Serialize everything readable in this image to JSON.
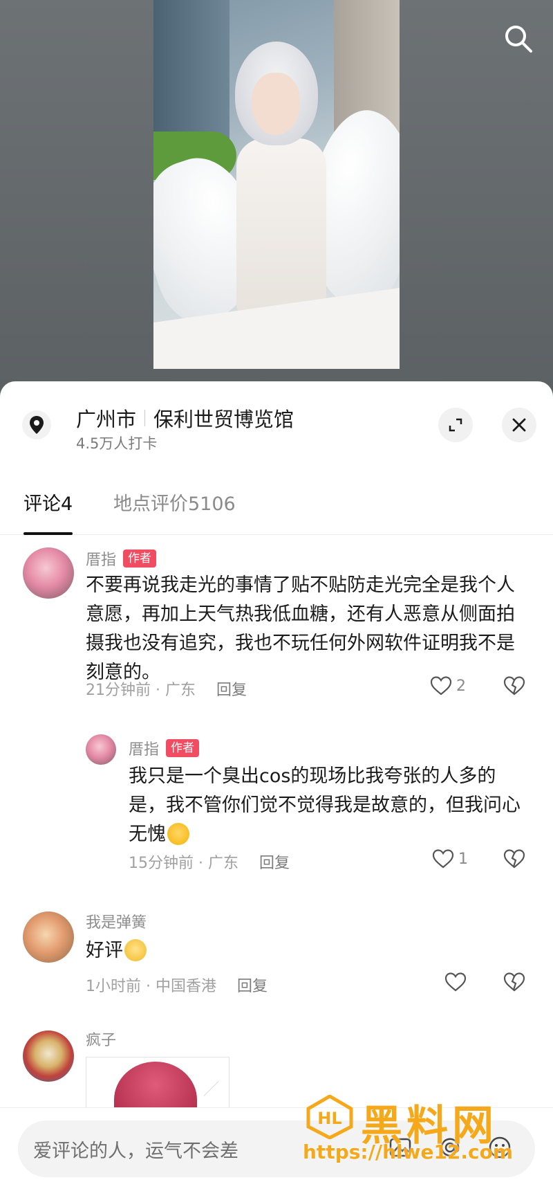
{
  "location": {
    "city": "广州市",
    "venue": "保利世贸博览馆",
    "checkins": "4.5万人打卡"
  },
  "tabs": [
    {
      "label": "评论",
      "count": "4"
    },
    {
      "label": "地点评价",
      "count": "5106"
    }
  ],
  "comments": [
    {
      "user": "厝指",
      "badge": "作者",
      "text": "不要再说我走光的事情了贴不贴防走光完全是我个人意愿，再加上天气热我低血糖，还有人恶意从侧面拍摄我也没有追究，我也不玩任何外网软件证明我不是刻意的。",
      "time": "21分钟前 · 广东",
      "reply": "回复",
      "likes": "2"
    },
    {
      "user": "厝指",
      "badge": "作者",
      "text": "我只是一个臭出cos的现场比我夸张的人多的是，我不管你们觉不觉得我是故意的，但我问心无愧",
      "emoji": "laugh-cry-emoji",
      "time": "15分钟前 · 广东",
      "reply": "回复",
      "likes": "1"
    },
    {
      "user": "我是弹簧",
      "text": "好评",
      "emoji": "teary-emoji",
      "time": "1小时前 · 中国香港",
      "reply": "回复",
      "likes": ""
    },
    {
      "user": "疯子"
    }
  ],
  "input": {
    "placeholder": "爱评论的人，运气不会差"
  },
  "watermark": {
    "title": "黑料网",
    "url": "https://hlwe12.com"
  },
  "colors": {
    "badge": "#f04d62",
    "watermark": "#f5a91a"
  }
}
